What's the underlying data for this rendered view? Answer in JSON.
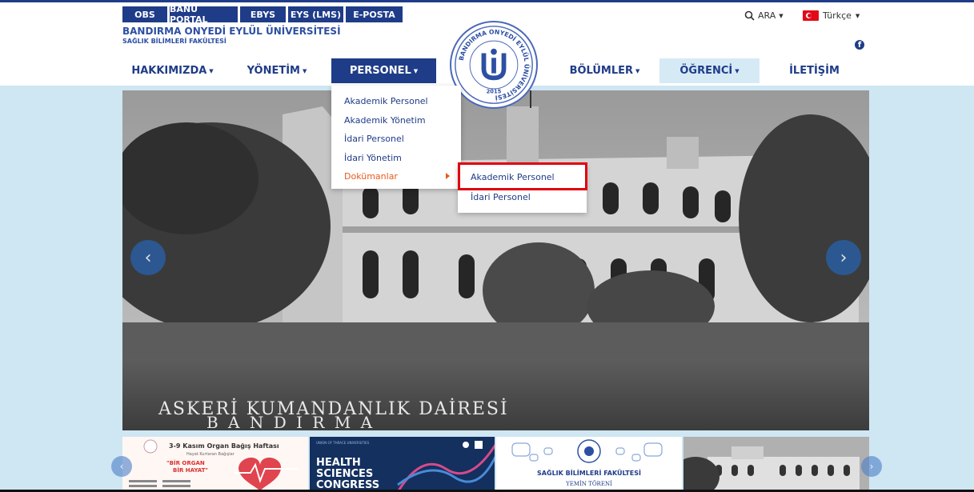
{
  "toplinks": [
    {
      "label": "OBS"
    },
    {
      "label": "BANÜ PORTAL"
    },
    {
      "label": "EBYS"
    },
    {
      "label": "EYS (LMS)"
    },
    {
      "label": "E-POSTA"
    }
  ],
  "header": {
    "university": "BANDIRMA ONYEDİ EYLÜL ÜNİVERSİTESİ",
    "faculty": "SAĞLIK BİLİMLERİ FAKÜLTESİ",
    "logo_ring_text": "BANDIRMA ONYEDİ EYLÜL ÜNİVERSİTESİ",
    "logo_year": "2015"
  },
  "utility": {
    "search_label": "ARA",
    "language": "Türkçe"
  },
  "nav": [
    {
      "label": "HAKKIMIZDA"
    },
    {
      "label": "YÖNETİM"
    },
    {
      "label": "PERSONEL"
    },
    {
      "label": "BÖLÜMLER"
    },
    {
      "label": "ÖĞRENCİ"
    },
    {
      "label": "İLETİŞİM"
    }
  ],
  "dropdown": [
    {
      "label": "Akademik Personel"
    },
    {
      "label": "Akademik Yönetim"
    },
    {
      "label": "İdari Personel"
    },
    {
      "label": "İdari Yönetim"
    },
    {
      "label": "Dokümanlar"
    }
  ],
  "submenu": [
    {
      "label": "Akademik Personel"
    },
    {
      "label": "İdari Personel"
    }
  ],
  "hero": {
    "caption_line1": "ASKERİ KUMANDANLIK DAİRESİ",
    "caption_line2": "B A N D I R M A"
  },
  "thumbs": {
    "t1_title": "3-9 Kasım Organ Bağış Haftası",
    "t1_sub": "Hayat Kurtaran Bağışlar",
    "t1_quote1": "\"BİR ORGAN",
    "t1_quote2": "BİR HAYAT\"",
    "t2_line0": "UNION OF THRACE UNIVERSITIES",
    "t2_line1": "HEALTH",
    "t2_line2": "SCIENCES",
    "t2_line3": "CONGRESS",
    "t3_title": "SAĞLIK BİLİMLERİ FAKÜLTESİ",
    "t3_sub": "YEMİN TÖRENİ"
  },
  "colors": {
    "brand": "#1f3c88",
    "accent_orange": "#e95a1c",
    "highlight_red": "#e0000f",
    "background": "#cfe6f3"
  }
}
